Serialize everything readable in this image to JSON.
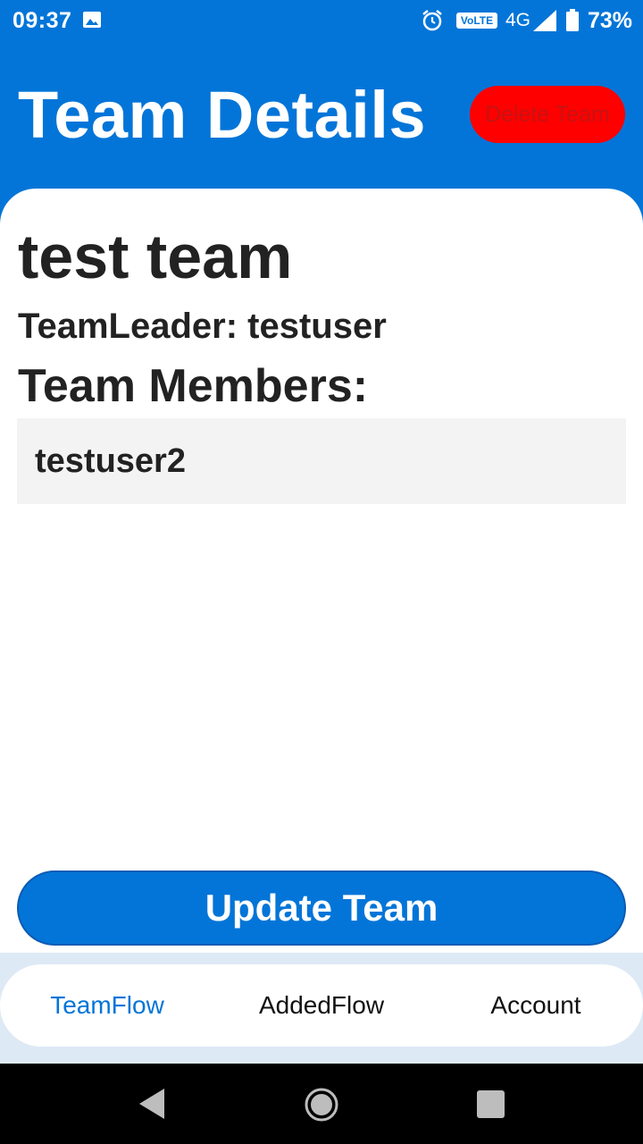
{
  "status_bar": {
    "time": "09:37",
    "volte": "VoLTE",
    "network": "4G",
    "battery": "73%"
  },
  "header": {
    "title": "Team Details",
    "delete_label": "Delete Team"
  },
  "team": {
    "name": "test team",
    "leader_line": "TeamLeader: testuser",
    "members_heading": "Team Members:",
    "members": [
      "testuser2"
    ]
  },
  "actions": {
    "update_label": "Update Team"
  },
  "bottom_nav": {
    "items": [
      {
        "label": "TeamFlow",
        "active": true
      },
      {
        "label": "AddedFlow",
        "active": false
      },
      {
        "label": "Account",
        "active": false
      }
    ]
  },
  "colors": {
    "primary": "#0375d8",
    "delete": "#ff0000",
    "member_bg": "#f3f3f3"
  }
}
